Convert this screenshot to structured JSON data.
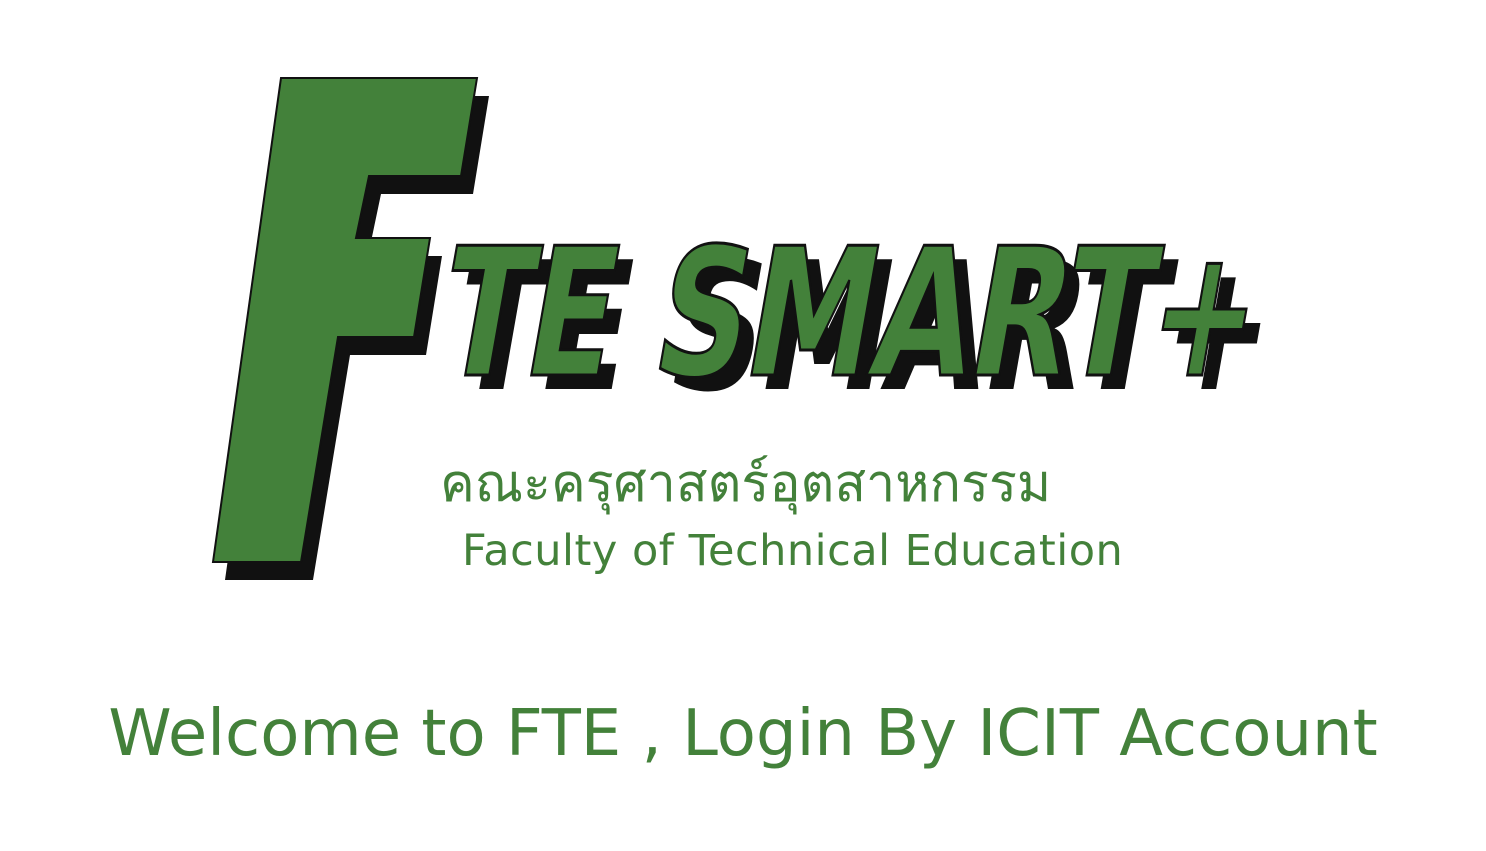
{
  "logo": {
    "letter": "F",
    "title": "TE SMART+",
    "thai_name": "คณะครุศาสตร์อุตสาหกรรม",
    "english_name": "Faculty of Technical Education",
    "colors": {
      "green": "#43813a",
      "shadow": "#111111",
      "background": "#ffffff"
    }
  },
  "welcome_message": "Welcome to FTE , Login By ICIT Account"
}
